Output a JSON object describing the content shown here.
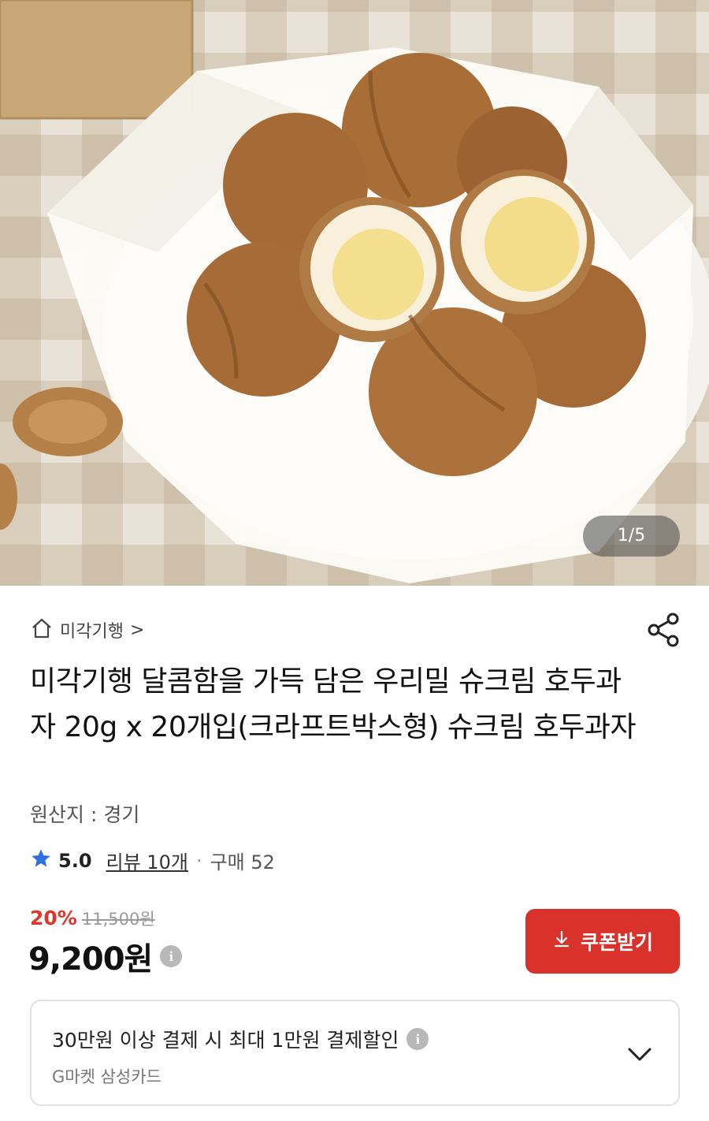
{
  "gallery": {
    "counter": "1/5"
  },
  "store": {
    "name": "미각기행",
    "chevron": ">"
  },
  "product": {
    "title": "미각기행 달콤함을 가득 담은 우리밀 슈크림 호두과자 20g x 20개입(크라프트박스형) 슈크림 호두과자",
    "origin": "원산지 : 경기"
  },
  "rating": {
    "score": "5.0",
    "reviews": "리뷰 10개",
    "separator": "·",
    "sales": "구매 52"
  },
  "price": {
    "discount": "20%",
    "original": "11,500원",
    "final": "9,200원",
    "info_glyph": "i"
  },
  "coupon": {
    "label": "쿠폰받기"
  },
  "promo": {
    "text": "30만원 이상 결제 시 최대 1만원 결제할인",
    "card": "G마켓 삼성카드",
    "info_glyph": "i"
  },
  "icons": {
    "home": "home-icon",
    "share": "share-icon",
    "star": "star-icon",
    "download": "download-icon",
    "expand": "chevron-down-icon"
  },
  "colors": {
    "accent": "#d8322b",
    "discount": "#e0352b",
    "star": "#2f6fe0"
  }
}
